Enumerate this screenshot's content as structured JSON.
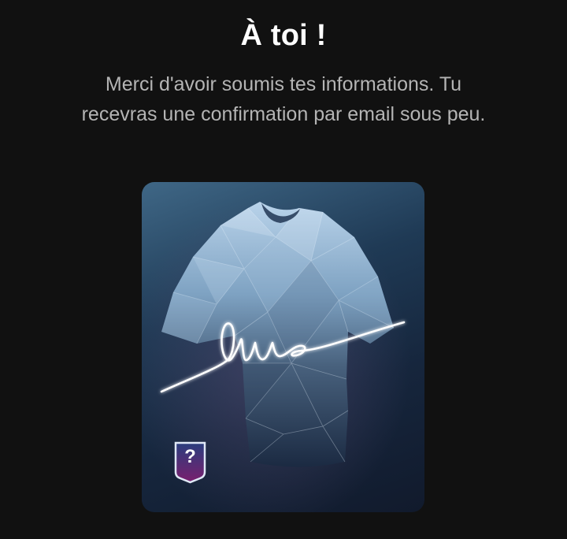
{
  "header": {
    "title": "À toi !"
  },
  "message": {
    "line1": "Merci d'avoir soumis tes informations. Tu",
    "line2": "recevras une confirmation par email sous peu."
  },
  "reward_card": {
    "image": "signed-jersey-illustration",
    "badge_mark": "?"
  },
  "colors": {
    "background": "#111111",
    "title": "#ffffff",
    "message": "#b4b4b4",
    "card_top": "#3f6786",
    "card_bottom": "#111a2c",
    "signature": "#ffffff"
  }
}
